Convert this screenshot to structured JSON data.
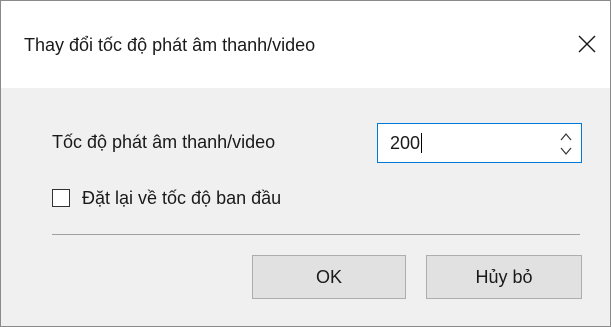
{
  "dialog": {
    "title": "Thay đổi tốc độ phát âm thanh/video",
    "close_icon": "close-icon"
  },
  "speed": {
    "label": "Tốc độ phát âm thanh/video",
    "value": "200",
    "up_icon": "chevron-up-icon",
    "down_icon": "chevron-down-icon"
  },
  "reset": {
    "label": "Đặt lại về tốc độ ban đầu",
    "checked": false
  },
  "buttons": {
    "ok": "OK",
    "cancel": "Hủy bỏ"
  },
  "colors": {
    "accent_focus_border": "#0078d7",
    "dialog_background": "#f0f0f0",
    "button_background": "#e1e1e1"
  }
}
